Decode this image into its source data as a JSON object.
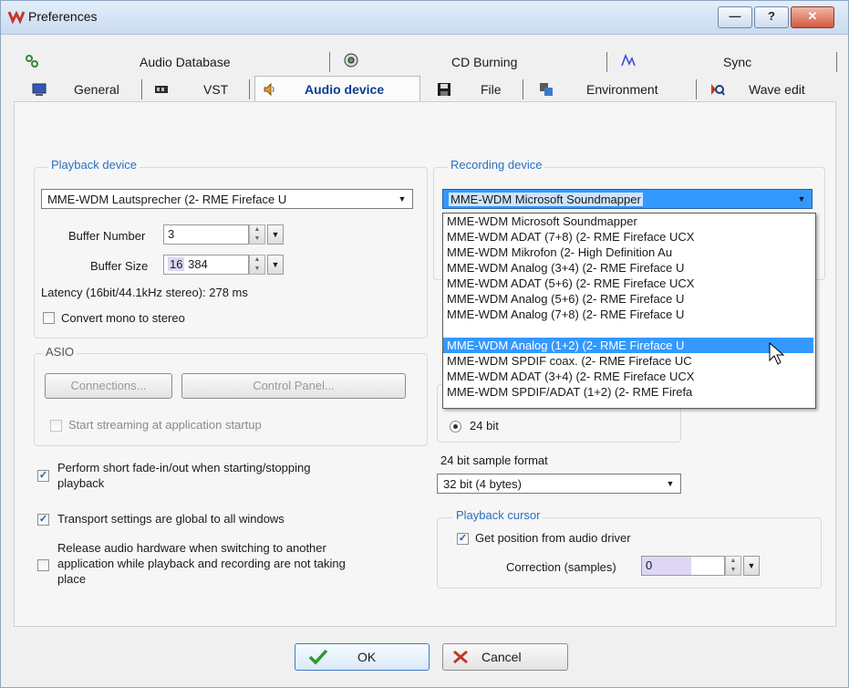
{
  "window": {
    "title": "Preferences"
  },
  "titlebar_buttons": {
    "minimize": "—",
    "help": "?",
    "close": "✕"
  },
  "tabs_row1": [
    {
      "label": "Audio Database",
      "icon": "database-icon"
    },
    {
      "label": "CD Burning",
      "icon": "cd-icon"
    },
    {
      "label": "Sync",
      "icon": "sync-icon"
    }
  ],
  "tabs_row2": [
    {
      "label": "General",
      "icon": "computer-icon"
    },
    {
      "label": "VST",
      "icon": "vst-icon"
    },
    {
      "label": "Audio device",
      "icon": "speaker-icon",
      "selected": true
    },
    {
      "label": "File",
      "icon": "floppy-icon"
    },
    {
      "label": "Environment",
      "icon": "environment-icon"
    },
    {
      "label": "Wave edit",
      "icon": "wave-edit-icon"
    }
  ],
  "playback": {
    "group_label": "Playback device",
    "device": "MME-WDM Lautsprecher (2- RME Fireface U",
    "buffer_number_label": "Buffer Number",
    "buffer_number": "3",
    "buffer_size_label": "Buffer Size",
    "buffer_size_a": "16",
    "buffer_size_b": "384",
    "latency": "Latency (16bit/44.1kHz stereo): 278 ms",
    "convert_mono_label": "Convert mono to stereo"
  },
  "asio": {
    "group_label": "ASIO",
    "connections_label": "Connections...",
    "control_panel_label": "Control Panel...",
    "streaming_label": "Start streaming at application startup"
  },
  "options": {
    "fade_line1": "Perform short fade-in/out when starting/stopping",
    "fade_line2": "playback",
    "transport_label": "Transport settings are global to all windows",
    "release_line1": "Release audio hardware when switching to another",
    "release_line2": "application while playback and recording are not taking",
    "release_line3": "place"
  },
  "recording": {
    "group_label": "Recording device",
    "device": "MME-WDM Microsoft Soundmapper",
    "options": [
      "MME-WDM Microsoft Soundmapper",
      "MME-WDM ADAT (7+8) (2- RME Fireface UCX",
      "MME-WDM Mikrofon (2- High Definition Au",
      "MME-WDM Analog (3+4) (2- RME Fireface U",
      "MME-WDM ADAT (5+6) (2- RME Fireface UCX",
      "MME-WDM Analog (5+6) (2- RME Fireface U",
      "MME-WDM Analog (7+8) (2- RME Fireface U",
      "MME-WDM Analog (1+2) (2- RME Fireface U",
      "MME-WDM SPDIF coax. (2- RME Fireface UC",
      "MME-WDM ADAT (3+4) (2- RME Fireface UCX",
      "MME-WDM SPDIF/ADAT (1+2) (2- RME Firefa"
    ],
    "highlighted_index": 7,
    "bits_label": "24 bit"
  },
  "sample_format": {
    "label": "24 bit sample format",
    "value": "32 bit (4 bytes)"
  },
  "cursor": {
    "group_label": "Playback cursor",
    "get_position_label": "Get position from audio driver",
    "correction_label": "Correction (samples)",
    "correction_value": "0"
  },
  "buttons": {
    "ok": "OK",
    "cancel": "Cancel"
  }
}
